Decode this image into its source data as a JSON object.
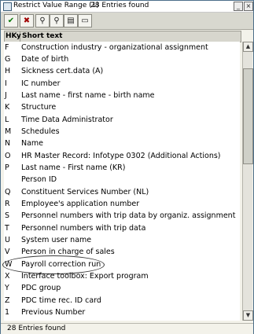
{
  "window": {
    "title": "Restrict Value Range (1)",
    "entries_found": "28 Entries found"
  },
  "toolbar": {
    "buttons": [
      "check-icon",
      "cancel-icon",
      "find-icon",
      "find-next-icon",
      "print-icon",
      "info-icon"
    ]
  },
  "table": {
    "headers": {
      "key": "HKy",
      "text": "Short text"
    },
    "rows": [
      {
        "key": "F",
        "text": "Construction industry - organizational assignment"
      },
      {
        "key": "G",
        "text": "Date of birth"
      },
      {
        "key": "H",
        "text": "Sickness cert.data (A)"
      },
      {
        "key": "I",
        "text": "IC number"
      },
      {
        "key": "J",
        "text": "Last name - first name - birth name"
      },
      {
        "key": "K",
        "text": "Structure"
      },
      {
        "key": "L",
        "text": "Time Data Administrator"
      },
      {
        "key": "M",
        "text": "Schedules"
      },
      {
        "key": "N",
        "text": "Name"
      },
      {
        "key": "O",
        "text": "HR Master Record: Infotype 0302 (Additional Actions)"
      },
      {
        "key": "P",
        "text": "Last name - First name (KR)"
      },
      {
        "key": "",
        "text": "Person ID"
      },
      {
        "key": "Q",
        "text": "Constituent Services Number (NL)"
      },
      {
        "key": "R",
        "text": "Employee's application number"
      },
      {
        "key": "S",
        "text": "Personnel numbers with trip data by organiz. assignment"
      },
      {
        "key": "T",
        "text": "Personnel numbers with trip data"
      },
      {
        "key": "U",
        "text": "System user name"
      },
      {
        "key": "V",
        "text": "Person in charge of sales"
      },
      {
        "key": "W",
        "text": "Payroll correction run"
      },
      {
        "key": "X",
        "text": "Interface toolbox: Export program"
      },
      {
        "key": "Y",
        "text": "PDC group"
      },
      {
        "key": "Z",
        "text": "PDC time rec. ID card"
      },
      {
        "key": "1",
        "text": "Previous Number"
      }
    ]
  },
  "status": {
    "text": "28 Entries found"
  },
  "colors": {
    "frame": "#4d6f8a",
    "background": "#f3f2ea",
    "header": "#d7d6cd"
  }
}
